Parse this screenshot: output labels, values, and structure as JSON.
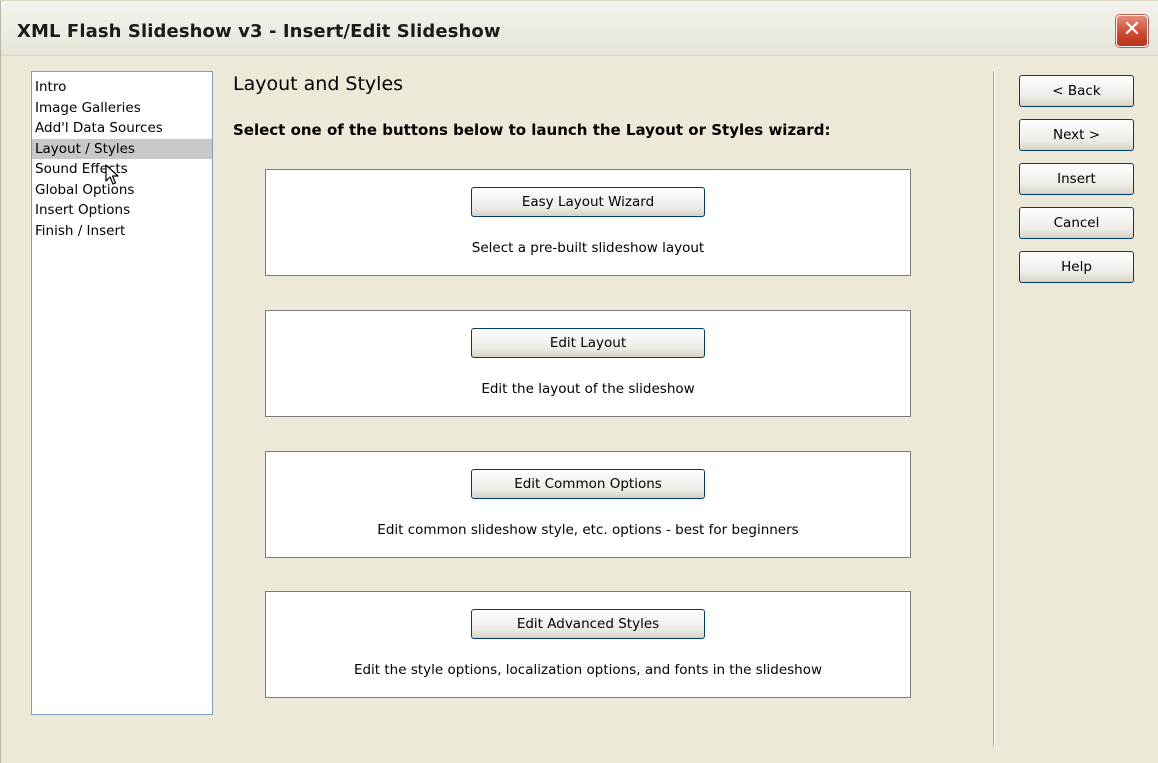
{
  "window": {
    "title": "XML Flash Slideshow v3 - Insert/Edit Slideshow",
    "close_label": "✕"
  },
  "nav": {
    "items": [
      {
        "label": "Intro",
        "selected": false
      },
      {
        "label": "Image Galleries",
        "selected": false
      },
      {
        "label": "Add'l Data Sources",
        "selected": false
      },
      {
        "label": "Layout / Styles",
        "selected": true
      },
      {
        "label": "Sound Effects",
        "selected": false
      },
      {
        "label": "Global Options",
        "selected": false
      },
      {
        "label": "Insert Options",
        "selected": false
      },
      {
        "label": "Finish / Insert",
        "selected": false
      }
    ]
  },
  "main": {
    "heading": "Layout and Styles",
    "instruction": "Select one of the buttons below to launch the Layout or Styles wizard:",
    "panels": [
      {
        "button": "Easy Layout Wizard",
        "description": "Select a pre-built slideshow layout"
      },
      {
        "button": "Edit Layout",
        "description": "Edit the layout of the slideshow"
      },
      {
        "button": "Edit Common Options",
        "description": "Edit common slideshow style, etc. options - best for beginners"
      },
      {
        "button": "Edit Advanced Styles",
        "description": "Edit the style options, localization options, and fonts in the slideshow"
      }
    ]
  },
  "actions": {
    "back": "< Back",
    "next": "Next >",
    "insert": "Insert",
    "cancel": "Cancel",
    "help": "Help"
  },
  "colors": {
    "window_bg": "#ece9d8",
    "selected_item_bg": "#c8c8c8",
    "button_border": "#003c74",
    "close_button": "#cf4b33"
  },
  "icons": {
    "close": "close-icon",
    "cursor": "mouse-pointer-icon"
  }
}
